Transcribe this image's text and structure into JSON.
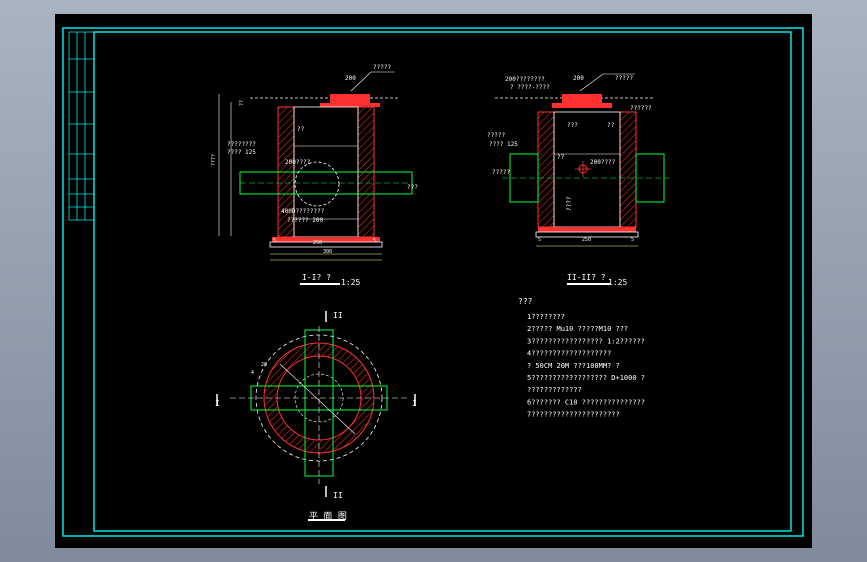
{
  "colors": {
    "background": "#000000",
    "border": "#00e5e5",
    "outline": "#ffffff",
    "wall_fill": "#ff3030",
    "pipe": "#00ff3c",
    "dim": "#ffff66"
  },
  "section_1": {
    "title": "I-I? ?",
    "scale": "1:25",
    "top_dim": "200",
    "labels": [
      "?????",
      "??",
      "????????",
      "???? 125",
      "200????",
      "400D????????",
      "?????? 200",
      "???"
    ],
    "bottom_dims": [
      "5",
      "250",
      "5",
      "300"
    ],
    "left_dim": "????",
    "side_mark": "??"
  },
  "section_2": {
    "title": "II-II? ?",
    "scale": "1:25",
    "top_dim": "200",
    "labels": [
      "200????????",
      "? ????-????",
      "?????",
      "??????",
      "???",
      "??",
      "?????",
      "???? 125",
      "?????",
      "??",
      "200????",
      "????"
    ],
    "bottom_dims": [
      "5",
      "250",
      "5"
    ]
  },
  "plan": {
    "title": "平 面 图",
    "marks": [
      "II",
      "I",
      "I",
      "II"
    ],
    "dims": [
      "4",
      "20"
    ]
  },
  "notes": {
    "heading": "???",
    "items": [
      "1????????",
      "2?????  Mu10    ?????M10       ???",
      "3?????????????????    1:2??????",
      "4???????????????????",
      "  ? 50CM    20M        ???100MM?          ?",
      "5??????????????????    D+1000   ?",
      "    ?????????????",
      "6???????    C10  ???????????????",
      "7?????????????????????"
    ]
  },
  "title_block": {
    "cells": [
      "",
      "",
      "",
      "",
      "",
      "",
      "",
      "",
      "",
      "",
      "",
      ""
    ]
  }
}
